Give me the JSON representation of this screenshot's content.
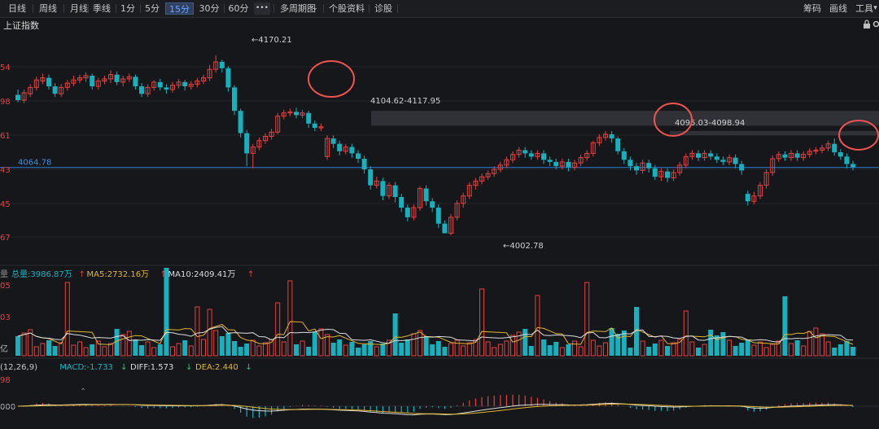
{
  "toolbar": {
    "periods": [
      "日线",
      "周线",
      "月线",
      "季线",
      "1分",
      "5分",
      "15分",
      "30分",
      "60分"
    ],
    "active_period": "15分",
    "more": "•••",
    "multi_period": "多周期图",
    "stock_info": "个股资料",
    "diagnose": "诊股",
    "chips": "筹码",
    "draw": "画线",
    "tools": "工具"
  },
  "index_name": "上证指数",
  "icons": {
    "lock": "lock-icon",
    "settings": "gear-icon",
    "collapse": "chevron-down-icon"
  },
  "colors": {
    "bg": "#16171b",
    "up": "#e5403f",
    "down": "#17b1be",
    "ma5": "#e0b62c",
    "ma10": "#dcdcdc",
    "ref_line": "#2d7fd6",
    "circle": "#ef5350"
  },
  "chart_data": [
    {
      "type": "candlestick",
      "title": "上证指数",
      "y_ticks": [
        "54",
        "98",
        "61",
        "43",
        "45",
        "67"
      ],
      "ylim": [
        3985,
        4190
      ],
      "reference_line": {
        "value": 4064.78,
        "label": "4064.78"
      },
      "annotations": {
        "high": {
          "value": 4170.21,
          "label": "4170.21"
        },
        "low": {
          "value": 4002.78,
          "label": "4002.78"
        },
        "zone1": {
          "label": "4104.62-4117.95"
        },
        "zone2": {
          "label": "4095.03-4098.94"
        }
      },
      "candles": [
        [
          4133,
          4128,
          4138,
          4126
        ],
        [
          4128,
          4135,
          4138,
          4125
        ],
        [
          4134,
          4140,
          4143,
          4131
        ],
        [
          4140,
          4147,
          4150,
          4137
        ],
        [
          4146,
          4149,
          4153,
          4143
        ],
        [
          4149,
          4141,
          4152,
          4138
        ],
        [
          4141,
          4134,
          4144,
          4131
        ],
        [
          4134,
          4140,
          4143,
          4131
        ],
        [
          4140,
          4144,
          4147,
          4137
        ],
        [
          4144,
          4147,
          4151,
          4141
        ],
        [
          4147,
          4149,
          4152,
          4144
        ],
        [
          4149,
          4151,
          4154,
          4145
        ],
        [
          4151,
          4141,
          4153,
          4138
        ],
        [
          4141,
          4146,
          4149,
          4138
        ],
        [
          4146,
          4148,
          4151,
          4143
        ],
        [
          4148,
          4152,
          4156,
          4144
        ],
        [
          4152,
          4145,
          4155,
          4142
        ],
        [
          4145,
          4148,
          4151,
          4141
        ],
        [
          4148,
          4150,
          4153,
          4145
        ],
        [
          4150,
          4141,
          4152,
          4138
        ],
        [
          4141,
          4134,
          4144,
          4131
        ],
        [
          4134,
          4140,
          4143,
          4131
        ],
        [
          4140,
          4145,
          4147,
          4137
        ],
        [
          4145,
          4140,
          4148,
          4137
        ],
        [
          4140,
          4138,
          4143,
          4134
        ],
        [
          4138,
          4142,
          4145,
          4135
        ],
        [
          4142,
          4145,
          4148,
          4139
        ],
        [
          4145,
          4141,
          4147,
          4137
        ],
        [
          4141,
          4143,
          4146,
          4138
        ],
        [
          4143,
          4146,
          4149,
          4140
        ],
        [
          4146,
          4149,
          4152,
          4143
        ],
        [
          4149,
          4157,
          4161,
          4146
        ],
        [
          4157,
          4164,
          4170.21,
          4154
        ],
        [
          4164,
          4158,
          4166,
          4154
        ],
        [
          4158,
          4140,
          4160,
          4136
        ],
        [
          4140,
          4118,
          4142,
          4114
        ],
        [
          4118,
          4097,
          4120,
          4093
        ],
        [
          4097,
          4078,
          4100,
          4066
        ],
        [
          4078,
          4084,
          4087,
          4064
        ],
        [
          4084,
          4090,
          4093,
          4081
        ],
        [
          4090,
          4094,
          4097,
          4087
        ],
        [
          4094,
          4098,
          4101,
          4091
        ],
        [
          4098,
          4113,
          4116,
          4096
        ],
        [
          4113,
          4116,
          4119,
          4110
        ],
        [
          4116,
          4117,
          4120,
          4113
        ],
        [
          4117,
          4114,
          4121,
          4111
        ],
        [
          4114,
          4116,
          4119,
          4111
        ],
        [
          4116,
          4106,
          4118,
          4102
        ],
        [
          4106,
          4102,
          4109,
          4099
        ],
        [
          4102,
          4103,
          4106,
          4099
        ],
        [
          4075,
          4092,
          4095,
          4072
        ],
        [
          4092,
          4087,
          4095,
          4083
        ],
        [
          4087,
          4080,
          4090,
          4076
        ],
        [
          4080,
          4084,
          4087,
          4077
        ],
        [
          4084,
          4078,
          4087,
          4074
        ],
        [
          4078,
          4073,
          4081,
          4069
        ],
        [
          4073,
          4063,
          4076,
          4059
        ],
        [
          4063,
          4048,
          4066,
          4044
        ],
        [
          4048,
          4052,
          4056,
          4045
        ],
        [
          4052,
          4038,
          4055,
          4034
        ],
        [
          4038,
          4048,
          4051,
          4035
        ],
        [
          4048,
          4037,
          4051,
          4032
        ],
        [
          4037,
          4027,
          4040,
          4023
        ],
        [
          4027,
          4018,
          4030,
          4014
        ],
        [
          4018,
          4027,
          4030,
          4015
        ],
        [
          4027,
          4045,
          4047,
          4024
        ],
        [
          4045,
          4033,
          4048,
          4029
        ],
        [
          4033,
          4027,
          4036,
          4023
        ],
        [
          4027,
          4012,
          4030,
          4008
        ],
        [
          4012,
          4003,
          4015,
          4002.78
        ],
        [
          4003,
          4018,
          4021,
          4001
        ],
        [
          4018,
          4031,
          4034,
          4015
        ],
        [
          4031,
          4038,
          4041,
          4027
        ],
        [
          4038,
          4048,
          4051,
          4035
        ],
        [
          4048,
          4052,
          4055,
          4044
        ],
        [
          4052,
          4056,
          4059,
          4049
        ],
        [
          4056,
          4059,
          4062,
          4053
        ],
        [
          4059,
          4063,
          4066,
          4056
        ],
        [
          4063,
          4067,
          4070,
          4060
        ],
        [
          4067,
          4072,
          4075,
          4064
        ],
        [
          4072,
          4077,
          4080,
          4069
        ],
        [
          4077,
          4081,
          4084,
          4074
        ],
        [
          4081,
          4078,
          4084,
          4074
        ],
        [
          4078,
          4075,
          4081,
          4072
        ],
        [
          4075,
          4078,
          4081,
          4072
        ],
        [
          4078,
          4072,
          4081,
          4068
        ],
        [
          4072,
          4070,
          4075,
          4066
        ],
        [
          4070,
          4066,
          4073,
          4063
        ],
        [
          4066,
          4070,
          4073,
          4063
        ],
        [
          4070,
          4065,
          4073,
          4061
        ],
        [
          4065,
          4069,
          4072,
          4062
        ],
        [
          4069,
          4074,
          4077,
          4066
        ],
        [
          4074,
          4078,
          4081,
          4071
        ],
        [
          4078,
          4088,
          4090,
          4075
        ],
        [
          4088,
          4093,
          4096,
          4085
        ],
        [
          4093,
          4096,
          4099,
          4090
        ],
        [
          4096,
          4092,
          4099,
          4088
        ],
        [
          4092,
          4080,
          4094,
          4077
        ],
        [
          4080,
          4072,
          4083,
          4068
        ],
        [
          4072,
          4066,
          4075,
          4062
        ],
        [
          4066,
          4062,
          4069,
          4058
        ],
        [
          4062,
          4069,
          4072,
          4059
        ],
        [
          4069,
          4064,
          4072,
          4060
        ],
        [
          4064,
          4056,
          4067,
          4053
        ],
        [
          4056,
          4061,
          4064,
          4052
        ],
        [
          4061,
          4055,
          4064,
          4051
        ],
        [
          4055,
          4060,
          4063,
          4052
        ],
        [
          4060,
          4067,
          4070,
          4057
        ],
        [
          4067,
          4075,
          4078,
          4064
        ],
        [
          4075,
          4078,
          4081,
          4072
        ],
        [
          4078,
          4074,
          4081,
          4071
        ],
        [
          4074,
          4078,
          4081,
          4071
        ],
        [
          4078,
          4075,
          4081,
          4072
        ],
        [
          4075,
          4072,
          4078,
          4069
        ],
        [
          4072,
          4070,
          4075,
          4067
        ],
        [
          4070,
          4074,
          4077,
          4067
        ],
        [
          4074,
          4068,
          4077,
          4064
        ],
        [
          4068,
          4062,
          4071,
          4058
        ],
        [
          4040,
          4033,
          4043,
          4029
        ],
        [
          4033,
          4038,
          4042,
          4030
        ],
        [
          4038,
          4048,
          4051,
          4035
        ],
        [
          4048,
          4060,
          4063,
          4045
        ],
        [
          4060,
          4073,
          4076,
          4057
        ],
        [
          4073,
          4077,
          4080,
          4070
        ],
        [
          4077,
          4074,
          4080,
          4071
        ],
        [
          4074,
          4078,
          4081,
          4071
        ],
        [
          4078,
          4074,
          4081,
          4071
        ],
        [
          4074,
          4077,
          4080,
          4071
        ],
        [
          4077,
          4080,
          4083,
          4074
        ],
        [
          4080,
          4081,
          4084,
          4077
        ],
        [
          4081,
          4083,
          4086,
          4078
        ],
        [
          4083,
          4087,
          4090,
          4080
        ],
        [
          4087,
          4079,
          4092,
          4076
        ],
        [
          4079,
          4075,
          4082,
          4072
        ],
        [
          4075,
          4068,
          4078,
          4064
        ],
        [
          4068,
          4065,
          4071,
          4062
        ]
      ]
    },
    {
      "type": "bar",
      "title": "总量",
      "legend": [
        {
          "label": "总量:3986.87万",
          "arrow": "↑",
          "color": "#17b1be"
        },
        {
          "label": "MA5:2732.16万",
          "arrow": "↑",
          "color": "#e0b62c"
        },
        {
          "label": "MA10:2409.41万",
          "arrow": "↑",
          "color": "#dcdcdc"
        }
      ],
      "y_ticks": [
        "05",
        "03",
        "亿"
      ]
    },
    {
      "type": "bar",
      "title": "MACD",
      "legend": [
        {
          "label": "(12,26,9)",
          "arrow": "",
          "color": "#c9c9c9"
        },
        {
          "label": "MACD:-1.733",
          "arrow": "↓",
          "color": "#17b1be"
        },
        {
          "label": "DIFF:1.573",
          "arrow": "↓",
          "color": "#dcdcdc"
        },
        {
          "label": "DEA:2.440",
          "arrow": "↓",
          "color": "#e0b62c"
        }
      ],
      "y_ticks": [
        "98",
        "000"
      ]
    }
  ]
}
